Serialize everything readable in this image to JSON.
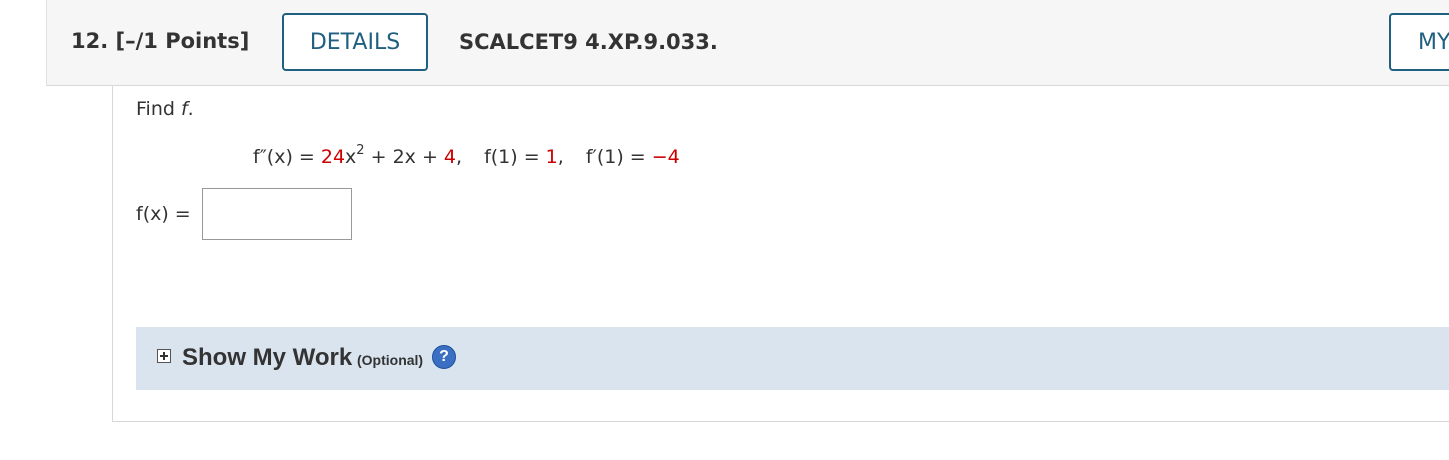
{
  "question": {
    "number_points": "12.  [–/1 Points]",
    "details_label": "DETAILS",
    "problem_id": "SCALCET9 4.XP.9.033.",
    "my_button_label": "MY"
  },
  "problem": {
    "find_prefix": "Find ",
    "find_var": "f",
    "find_suffix": ".",
    "equation": {
      "f2_lhs": "f″(x) = ",
      "coef": "24",
      "x_term": "x",
      "exponent": "2",
      "middle": " + 2x + ",
      "constant": "4",
      "sep1": ",",
      "f1_lhs": "f(1) = ",
      "f1_val": "1",
      "sep2": ",",
      "fp_lhs": "f′(1) = ",
      "fp_val": "−4"
    },
    "answer_label": "f(x)  =",
    "answer_value": ""
  },
  "show_my_work": {
    "title": "Show My Work",
    "optional": "(Optional)",
    "help_glyph": "?"
  },
  "colors": {
    "given_value_red": "#cc0000",
    "button_border": "#1f5f7f",
    "show_work_bg": "#d9e4ef",
    "help_icon_blue": "#3b6fc4"
  },
  "icons": {
    "expand": "plus-box-icon",
    "help": "help-icon"
  }
}
